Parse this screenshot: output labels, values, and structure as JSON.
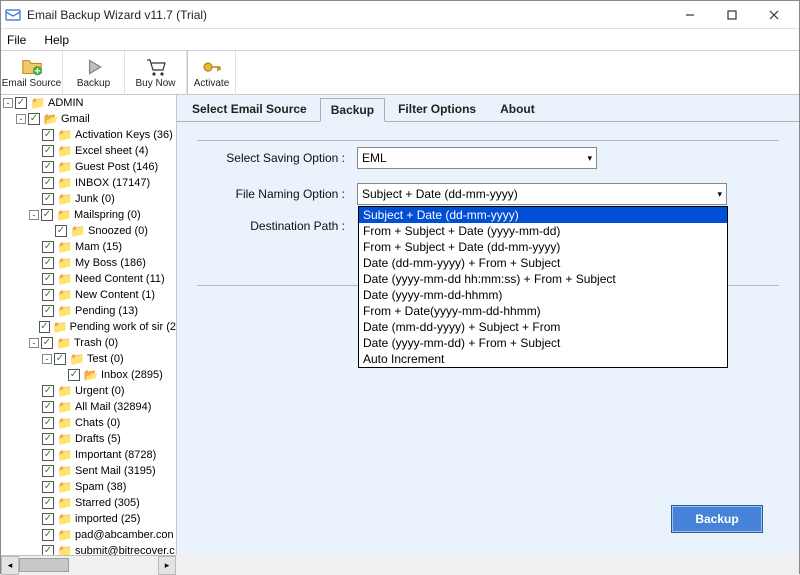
{
  "window": {
    "title": "Email Backup Wizard v11.7 (Trial)"
  },
  "menubar": [
    "File",
    "Help"
  ],
  "toolbar": {
    "email_source_label": "Email Source",
    "backup_label": "Backup",
    "buynow_label": "Buy Now",
    "activate_label": "Activate"
  },
  "tree": [
    {
      "depth": 0,
      "toggle": "-",
      "label": "ADMIN"
    },
    {
      "depth": 1,
      "toggle": "-",
      "label": "Gmail",
      "open": true
    },
    {
      "depth": 2,
      "label": "Activation Keys (36)"
    },
    {
      "depth": 2,
      "label": "Excel sheet (4)"
    },
    {
      "depth": 2,
      "label": "Guest Post (146)"
    },
    {
      "depth": 2,
      "label": "INBOX (17147)"
    },
    {
      "depth": 2,
      "label": "Junk (0)"
    },
    {
      "depth": 2,
      "toggle": "-",
      "label": "Mailspring (0)"
    },
    {
      "depth": 3,
      "label": "Snoozed (0)"
    },
    {
      "depth": 2,
      "label": "Mam (15)"
    },
    {
      "depth": 2,
      "label": "My Boss (186)"
    },
    {
      "depth": 2,
      "label": "Need Content (11)"
    },
    {
      "depth": 2,
      "label": "New Content (1)"
    },
    {
      "depth": 2,
      "label": "Pending (13)"
    },
    {
      "depth": 2,
      "label": "Pending work of sir (2"
    },
    {
      "depth": 2,
      "toggle": "-",
      "label": "Trash (0)"
    },
    {
      "depth": 3,
      "toggle": "-",
      "label": "Test (0)"
    },
    {
      "depth": 4,
      "label": "Inbox (2895)",
      "open": true
    },
    {
      "depth": 2,
      "label": "Urgent (0)"
    },
    {
      "depth": 2,
      "label": "All Mail (32894)"
    },
    {
      "depth": 2,
      "label": "Chats (0)"
    },
    {
      "depth": 2,
      "label": "Drafts (5)"
    },
    {
      "depth": 2,
      "label": "Important (8728)"
    },
    {
      "depth": 2,
      "label": "Sent Mail (3195)"
    },
    {
      "depth": 2,
      "label": "Spam (38)"
    },
    {
      "depth": 2,
      "label": "Starred (305)"
    },
    {
      "depth": 2,
      "label": "imported (25)"
    },
    {
      "depth": 2,
      "label": "pad@abcamber.con"
    },
    {
      "depth": 2,
      "label": "submit@bitrecover.c"
    }
  ],
  "tabs": [
    "Select Email Source",
    "Backup",
    "Filter Options",
    "About"
  ],
  "active_tab": 1,
  "form": {
    "saving_label": "Select Saving Option :",
    "saving_value": "EML",
    "naming_label": "File Naming Option :",
    "naming_value": "Subject + Date (dd-mm-yyyy)",
    "dest_label": "Destination Path :",
    "backup_button": "Backup"
  },
  "naming_options": [
    "Subject + Date (dd-mm-yyyy)",
    "From + Subject + Date (yyyy-mm-dd)",
    "From + Subject + Date (dd-mm-yyyy)",
    "Date (dd-mm-yyyy) + From + Subject",
    "Date (yyyy-mm-dd hh:mm:ss) + From + Subject",
    "Date (yyyy-mm-dd-hhmm)",
    "From + Date(yyyy-mm-dd-hhmm)",
    "Date (mm-dd-yyyy) + Subject + From",
    "Date (yyyy-mm-dd) + From + Subject",
    "Auto Increment"
  ]
}
